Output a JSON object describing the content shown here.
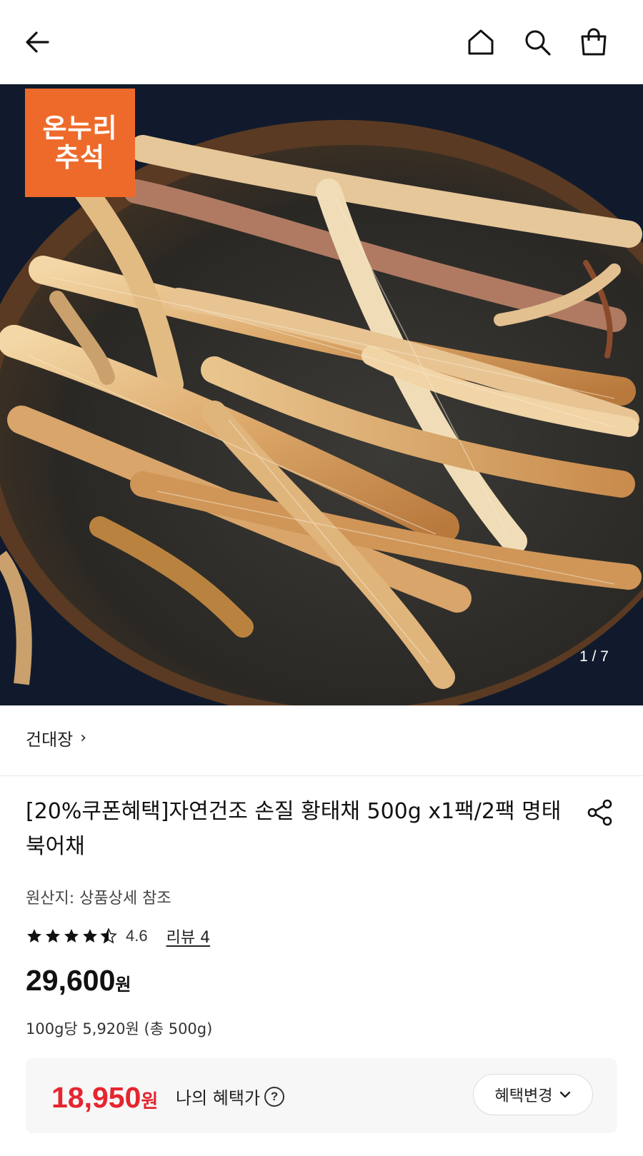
{
  "badge": {
    "line1": "온누리",
    "line2": "추석"
  },
  "gallery": {
    "pager": "1 / 7"
  },
  "brand": {
    "name": "건대장",
    "chevron": "›"
  },
  "product": {
    "title": "[20%쿠폰혜택]자연건조 손질 황태채 500g x1팩/2팩 명태 북어채",
    "origin": "원산지: 상품상세 참조",
    "rating": 4.6,
    "rating_text": "4.6",
    "review_link": "리뷰 4",
    "price": "29,600",
    "price_unit": "원",
    "unit_price": "100g당 5,920원 (총 500g)"
  },
  "benefit": {
    "price": "18,950",
    "price_unit": "원",
    "label": "나의 혜택가",
    "help": "?",
    "button_label": "혜택변경",
    "button_chevron": "⌄"
  },
  "colors": {
    "badge_bg": "#ee6a2b",
    "benefit_red": "#e5252f"
  },
  "icons": [
    "back-icon",
    "home-icon",
    "search-icon",
    "cart-icon",
    "share-icon",
    "help-icon",
    "star-icon"
  ]
}
